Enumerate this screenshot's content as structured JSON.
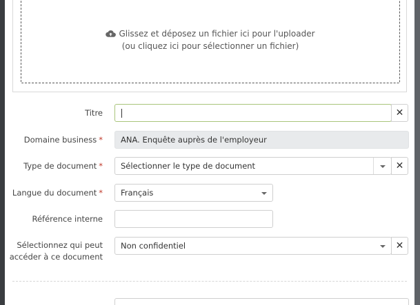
{
  "dropzone": {
    "line1": "Glissez et déposez un fichier ici pour l'uploader",
    "line2": "(ou cliquez ici pour sélectionner un fichier)",
    "icon": "cloud-upload-icon"
  },
  "form": {
    "titre": {
      "label": "Titre",
      "value": ""
    },
    "domaine": {
      "label": "Domaine business",
      "required": "*",
      "value": "ANA. Enquête auprès de l'employeur"
    },
    "type": {
      "label": "Type de document",
      "required": "*",
      "value": "Sélectionner le type de document"
    },
    "langue": {
      "label": "Langue du document",
      "required": "*",
      "value": "Français"
    },
    "reference": {
      "label": "Référence interne",
      "value": ""
    },
    "acces": {
      "label_line1": "Sélectionnez qui peut",
      "label_line2": "accéder à ce document",
      "value": "Non confidentiel"
    },
    "clear_symbol": "✕"
  }
}
